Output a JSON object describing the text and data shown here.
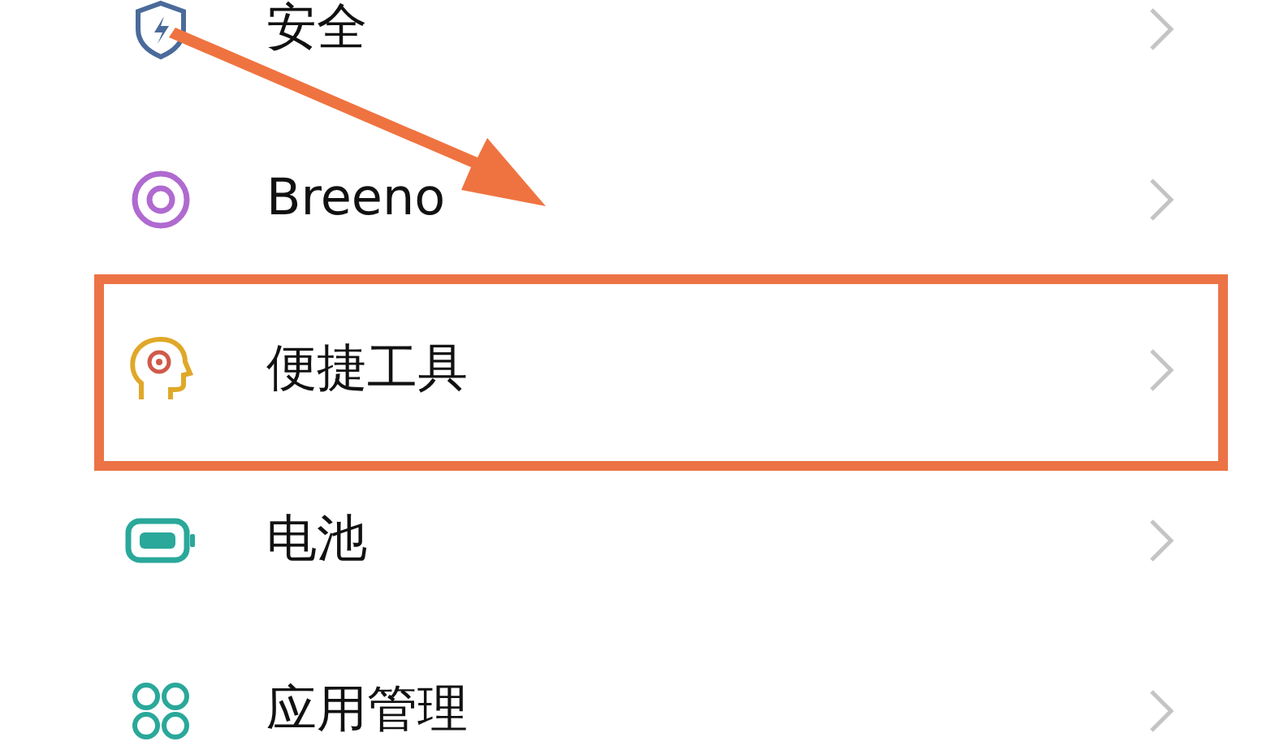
{
  "settings_items": [
    {
      "label": "安全",
      "kind": "shield",
      "highlighted": false
    },
    {
      "label": "Breeno",
      "kind": "ring",
      "highlighted": false
    },
    {
      "label": "便捷工具",
      "kind": "head",
      "highlighted": true
    },
    {
      "label": "电池",
      "kind": "battery",
      "highlighted": false
    },
    {
      "label": "应用管理",
      "kind": "apps",
      "highlighted": false
    }
  ]
}
